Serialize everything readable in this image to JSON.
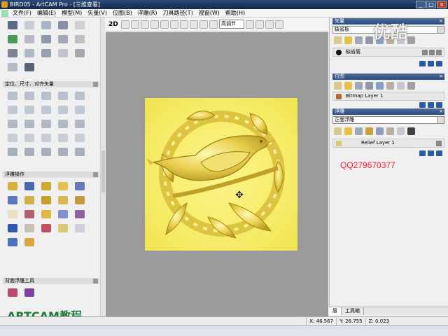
{
  "window": {
    "title": "BIRD05 - ArtCAM Pro - [三维查看]"
  },
  "menu": {
    "items": [
      "文件(F)",
      "编辑(E)",
      "模型(M)",
      "矢量(V)",
      "位图(B)",
      "浮雕(R)",
      "刀具路径(T)",
      "视窗(W)",
      "帮助(H)"
    ]
  },
  "left_panel": {
    "sections": [
      {
        "label": "定位、尺寸、对齐矢量"
      },
      {
        "label": "浮雕操作"
      },
      {
        "label": "背面浮雕工具"
      }
    ],
    "footer_label": "ARTCAM教程"
  },
  "toolbar3d": {
    "mode_2d": "2D",
    "render_combo": "高调节"
  },
  "right_panel": {
    "vector": {
      "title": "矢量",
      "combo": "缺省板",
      "layer": "缺省层"
    },
    "bitmap": {
      "title": "位图",
      "layer": "Bitmap Layer 1"
    },
    "relief": {
      "title": "浮雕",
      "combo": "正面浮雕",
      "layer": "Relief Layer 1"
    },
    "tabs": [
      "层",
      "工具箱"
    ]
  },
  "overlay": {
    "qq": "QQ279670377",
    "watermark": "优酷"
  },
  "status": {
    "x": "X: 46.567",
    "y": "Y: 26.755",
    "z": "Z: 0.023"
  },
  "colors": {
    "relief_yellow": "#f6ec6a",
    "viewport_gray": "#9b9b9b",
    "qq_red": "#ff2233",
    "label_green": "#1f7a3a"
  }
}
